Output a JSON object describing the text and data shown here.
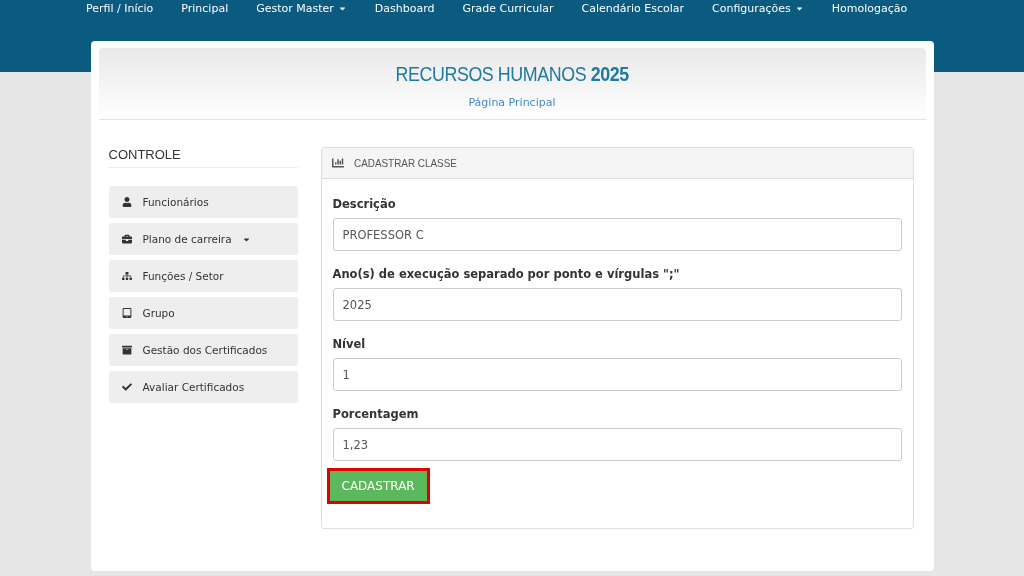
{
  "navbar": {
    "items": [
      {
        "label": "Perfil / Início",
        "dropdown": false
      },
      {
        "label": "Principal",
        "dropdown": false
      },
      {
        "label": "Gestor Master",
        "dropdown": true
      },
      {
        "label": "Dashboard",
        "dropdown": false
      },
      {
        "label": "Grade Curricular",
        "dropdown": false
      },
      {
        "label": "Calendário Escolar",
        "dropdown": false
      },
      {
        "label": "Configurações",
        "dropdown": true
      },
      {
        "label": "Homologação",
        "dropdown": false
      }
    ]
  },
  "header": {
    "title": "RECURSOS HUMANOS **2025**",
    "subtitle": "Página Principal"
  },
  "sidebar": {
    "title": "CONTROLE",
    "items": [
      {
        "label": "Funcionários",
        "dropdown": false
      },
      {
        "label": "Plano de carreira",
        "dropdown": true
      },
      {
        "label": "Funções / Setor",
        "dropdown": false
      },
      {
        "label": "Grupo",
        "dropdown": false
      },
      {
        "label": "Gestão dos Certificados",
        "dropdown": false
      },
      {
        "label": "Avaliar Certificados",
        "dropdown": false
      }
    ]
  },
  "panel": {
    "title": "CADASTRAR CLASSE",
    "fields": [
      {
        "label": "Descrição",
        "value": "PROFESSOR C"
      },
      {
        "label": "Ano(s) de execução separado por ponto e vírgulas \";\"",
        "value": "2025"
      },
      {
        "label": "Nível",
        "value": "1"
      },
      {
        "label": "Porcentagem",
        "value": "1,23"
      }
    ],
    "submit": {
      "label": "CADASTRAR",
      "highlighted": true
    }
  }
}
